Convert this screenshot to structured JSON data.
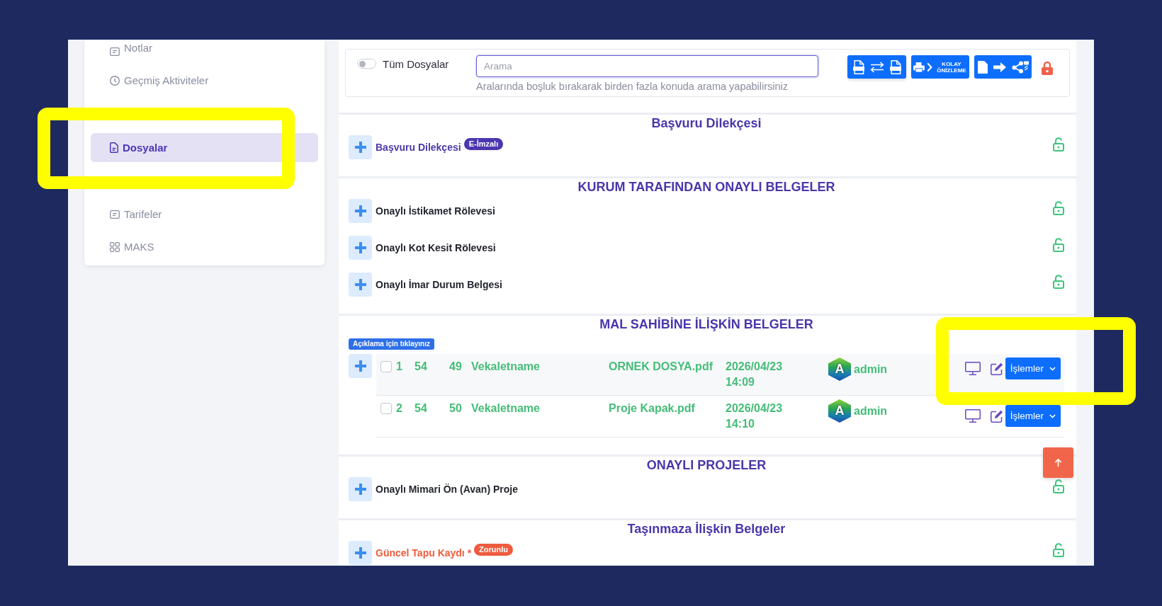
{
  "sidebar": {
    "items": [
      {
        "label": "Notlar",
        "selected": false
      },
      {
        "label": "Geçmiş Aktiviteler",
        "selected": false
      },
      {
        "label": "Dosyalar",
        "selected": true,
        "highlighted": true
      },
      {
        "label": "Tarifeler",
        "selected": false
      },
      {
        "label": "MAKS",
        "selected": false
      }
    ]
  },
  "toolbar": {
    "all_files": {
      "label": "Tüm Dosyalar",
      "on": false
    },
    "search": {
      "placeholder": "Arama",
      "hint": "Aralarında boşluk bırakarak birden fazla konuda arama yapabilirsiniz"
    },
    "preview_button": {
      "label": "KOLAY ÖNİZLEME"
    },
    "locked": true
  },
  "sections": [
    {
      "title": "Başvuru Dilekçesi",
      "documents": [
        {
          "kind": "e-signed",
          "label": "Başvuru Dilekçesi",
          "badge": "E-İmzalı",
          "locked": false
        }
      ]
    },
    {
      "title": "KURUM TARAFINDAN ONAYLI BELGELER",
      "documents": [
        {
          "kind": "plain",
          "label": "Onaylı İstikamet Rölevesi",
          "locked": false
        },
        {
          "kind": "plain",
          "label": "Onaylı Kot Kesit Rölevesi",
          "locked": false
        },
        {
          "kind": "plain",
          "label": "Onaylı İmar Durum Belgesi",
          "locked": false
        }
      ]
    },
    {
      "title": "MAL SAHİBİNE İLİŞKİN BELGELER",
      "note": "Açıklama için tıklayınız",
      "files": [
        {
          "checked": false,
          "highlighted": true,
          "cells": [
            "1",
            "54",
            "49",
            "Vekaletname",
            "ORNEK DOSYA.pdf",
            "2026/04/23 14:09"
          ],
          "avatar": "A",
          "user": "admin",
          "action": "İşlemler"
        },
        {
          "checked": false,
          "highlighted": false,
          "cells": [
            "2",
            "54",
            "50",
            "Vekaletname",
            "Proje Kapak.pdf",
            "2026/04/23 14:10"
          ],
          "avatar": "A",
          "user": "admin",
          "action": "İşlemler"
        }
      ]
    },
    {
      "title": "ONAYLI PROJELER",
      "documents": [
        {
          "kind": "plain",
          "label": "Onaylı Mimari Ön (Avan) Proje",
          "locked": false
        }
      ]
    },
    {
      "title": "Taşınmaza İlişkin Belgeler",
      "documents": [
        {
          "kind": "required",
          "label": "Güncel Tapu Kaydı *",
          "badge": "Zorunlu",
          "locked": false
        }
      ]
    }
  ]
}
